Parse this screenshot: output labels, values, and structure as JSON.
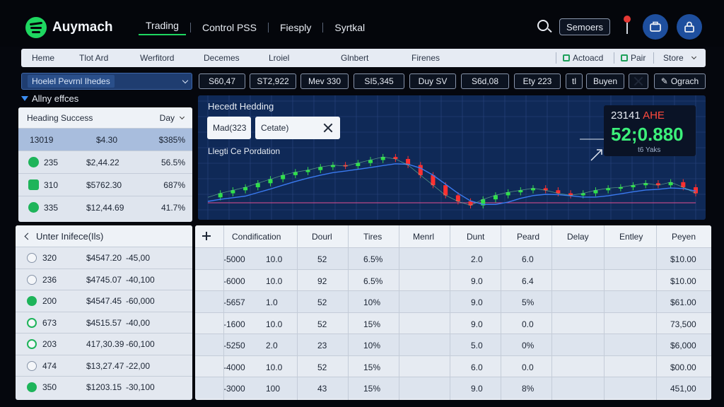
{
  "app": {
    "brand": "Auymach",
    "nav": [
      "Trading",
      "Control PSS",
      "Fiesply",
      "Syrtkal"
    ],
    "sensors_label": "Semoers",
    "icons": [
      "search-icon",
      "pin-icon",
      "briefcase-icon",
      "lock-icon"
    ],
    "accent": "#1ed760"
  },
  "tabs": {
    "items": [
      "Heme",
      "Tlot Ard",
      "Werfitord",
      "Decemes",
      "Lroiel",
      "Glnbert",
      "Firenes"
    ],
    "right": {
      "account": "Actoacd",
      "pair": "Pair",
      "store": "Store"
    }
  },
  "controls": {
    "select_value": "Hoelel Pevrnl Ihedes",
    "pills": [
      "S60,47",
      "ST2,922",
      "Mev 330",
      "SI5,345",
      "Duy SV",
      "S6d,08",
      "Ety 223",
      "tl",
      "Buyen",
      "Ograch"
    ]
  },
  "left_panel": {
    "header": "Allny effces",
    "title": "Heading Success",
    "dropdown": "Day",
    "rows": [
      {
        "a": "13019",
        "b": "$4.30",
        "c": "$385%"
      },
      {
        "a": "235",
        "b": "$2,44.22",
        "c": "56.5%"
      },
      {
        "a": "310",
        "b": "$5762.30",
        "c": "687%"
      },
      {
        "a": "335",
        "b": "$12,44.69",
        "c": "41.7%"
      }
    ]
  },
  "chart": {
    "title": "Hecedt Hedding",
    "subtitle": "Llegti Ce Pordation",
    "chip1": "Mad(323",
    "chip2": "Cetate)",
    "quote_top": "23141",
    "quote_tag": "AHE",
    "quote_price": "52;0.880",
    "quote_sub": "t6 Yaks",
    "colors": {
      "up": "#2fe04a",
      "down": "#ff3030",
      "ma": "#3a7af0"
    }
  },
  "chart_data": {
    "type": "line",
    "title": "Hecedt Hedding",
    "subtitle": "Llegti Ce Pordation",
    "x": [
      1,
      2,
      3,
      4,
      5,
      6,
      7,
      8,
      9,
      10,
      11,
      12,
      13,
      14,
      15,
      16,
      17,
      18,
      19,
      20,
      21,
      22,
      23,
      24,
      25,
      26,
      27,
      28,
      29,
      30,
      31,
      32,
      33,
      34,
      35,
      36,
      37,
      38,
      39,
      40
    ],
    "series": [
      {
        "values": [
          48,
          52,
          55,
          58,
          62,
          66,
          70,
          73,
          75,
          78,
          80,
          79,
          82,
          85,
          88,
          86,
          80,
          70,
          60,
          50,
          44,
          40,
          46,
          50,
          53,
          55,
          57,
          55,
          52,
          50,
          52,
          55,
          57,
          58,
          60,
          62,
          60,
          63,
          58,
          52
        ]
      }
    ],
    "ylim": [
      30,
      100
    ],
    "grid": true
  },
  "left_list": {
    "header": "Unter Inifece(Ils)",
    "rows": [
      {
        "id": "320",
        "val": "$4547.20",
        "chg": "-45,00"
      },
      {
        "id": "236",
        "val": "$4745.07",
        "chg": "-40,100"
      },
      {
        "id": "200",
        "val": "$4547.45",
        "chg": "-60,000"
      },
      {
        "id": "673",
        "val": "$4515.57",
        "chg": "-40,00"
      },
      {
        "id": "203",
        "val": "417,30.39",
        "chg": "-60,100"
      },
      {
        "id": "474",
        "val": "$13,27.47",
        "chg": "-22,00"
      },
      {
        "id": "350",
        "val": "$1203.15",
        "chg": "-30,100"
      }
    ]
  },
  "table": {
    "headers": [
      "Condification",
      "Dourl",
      "Tires",
      "Menrl",
      "Dunt",
      "Peard",
      "Delay",
      "Entley",
      "Peyen"
    ],
    "rows": [
      [
        "-5000",
        "10.0",
        "52",
        "6.5%",
        "",
        "2.0",
        "6.0",
        "",
        "",
        "$10.00"
      ],
      [
        "-6000",
        "10.0",
        "92",
        "6.5%",
        "",
        "9.0",
        "6.4",
        "",
        "",
        "$10.00"
      ],
      [
        "-5657",
        "1.0",
        "52",
        "10%",
        "",
        "9.0",
        "5%",
        "",
        "",
        "$61.00"
      ],
      [
        "-1600",
        "10.0",
        "52",
        "15%",
        "",
        "9.0",
        "0.0",
        "",
        "",
        "73,500"
      ],
      [
        "-5250",
        "2.0",
        "23",
        "10%",
        "",
        "5.0",
        "0%",
        "",
        "",
        "$6,000"
      ],
      [
        "-4000",
        "10.0",
        "52",
        "15%",
        "",
        "6.0",
        "0.0",
        "",
        "",
        "$00.00"
      ],
      [
        "-3000",
        "100",
        "43",
        "15%",
        "",
        "9.0",
        "8%",
        "",
        "",
        "451,00"
      ]
    ]
  }
}
